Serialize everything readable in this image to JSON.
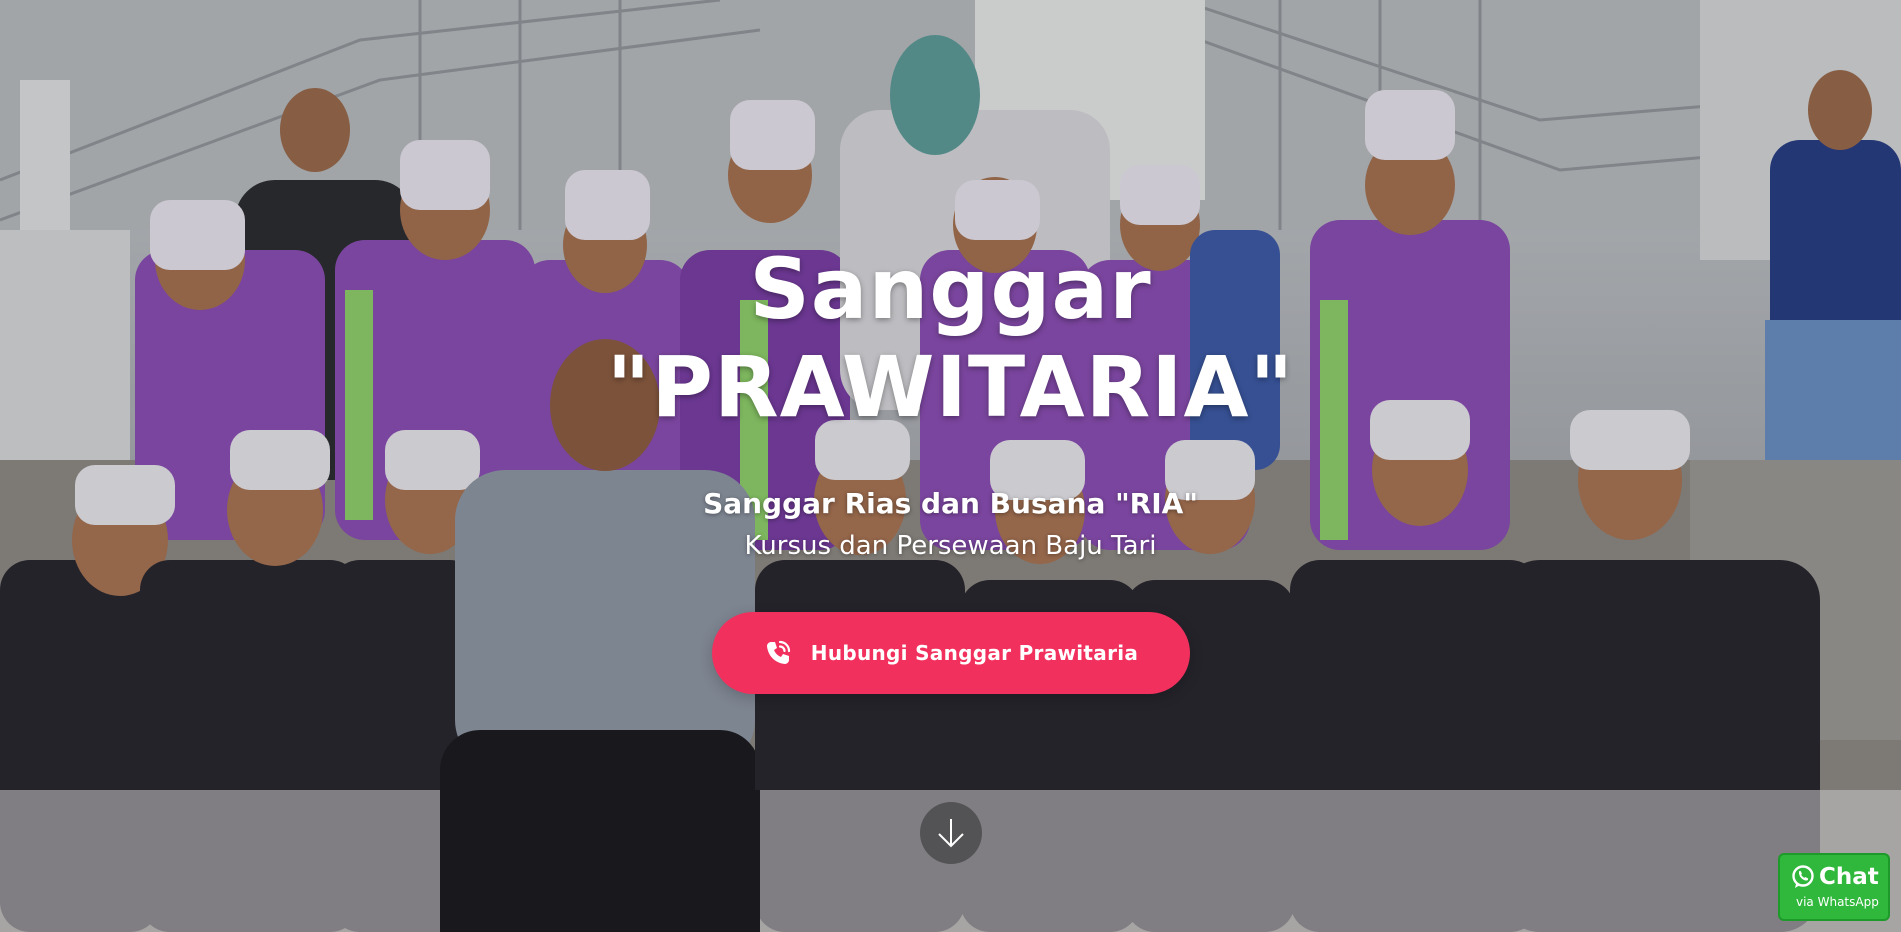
{
  "hero": {
    "title_line1": "Sanggar",
    "title_line2": "\"PRAWITARIA\"",
    "subtitle": "Sanggar Rias dan Busana \"RIA\"",
    "tagline": "Kursus dan Persewaan Baju Tari",
    "cta_label": "Hubungi Sanggar Prawitaria",
    "cta_icon": "phone-ringing-icon",
    "scroll_icon": "arrow-down-icon"
  },
  "whatsapp": {
    "chat_label": "Chat",
    "via_label": "via WhatsApp",
    "icon": "whatsapp-icon"
  },
  "colors": {
    "cta_background": "#f2305e",
    "whatsapp_green": "#2fb83b",
    "text": "#ffffff"
  }
}
